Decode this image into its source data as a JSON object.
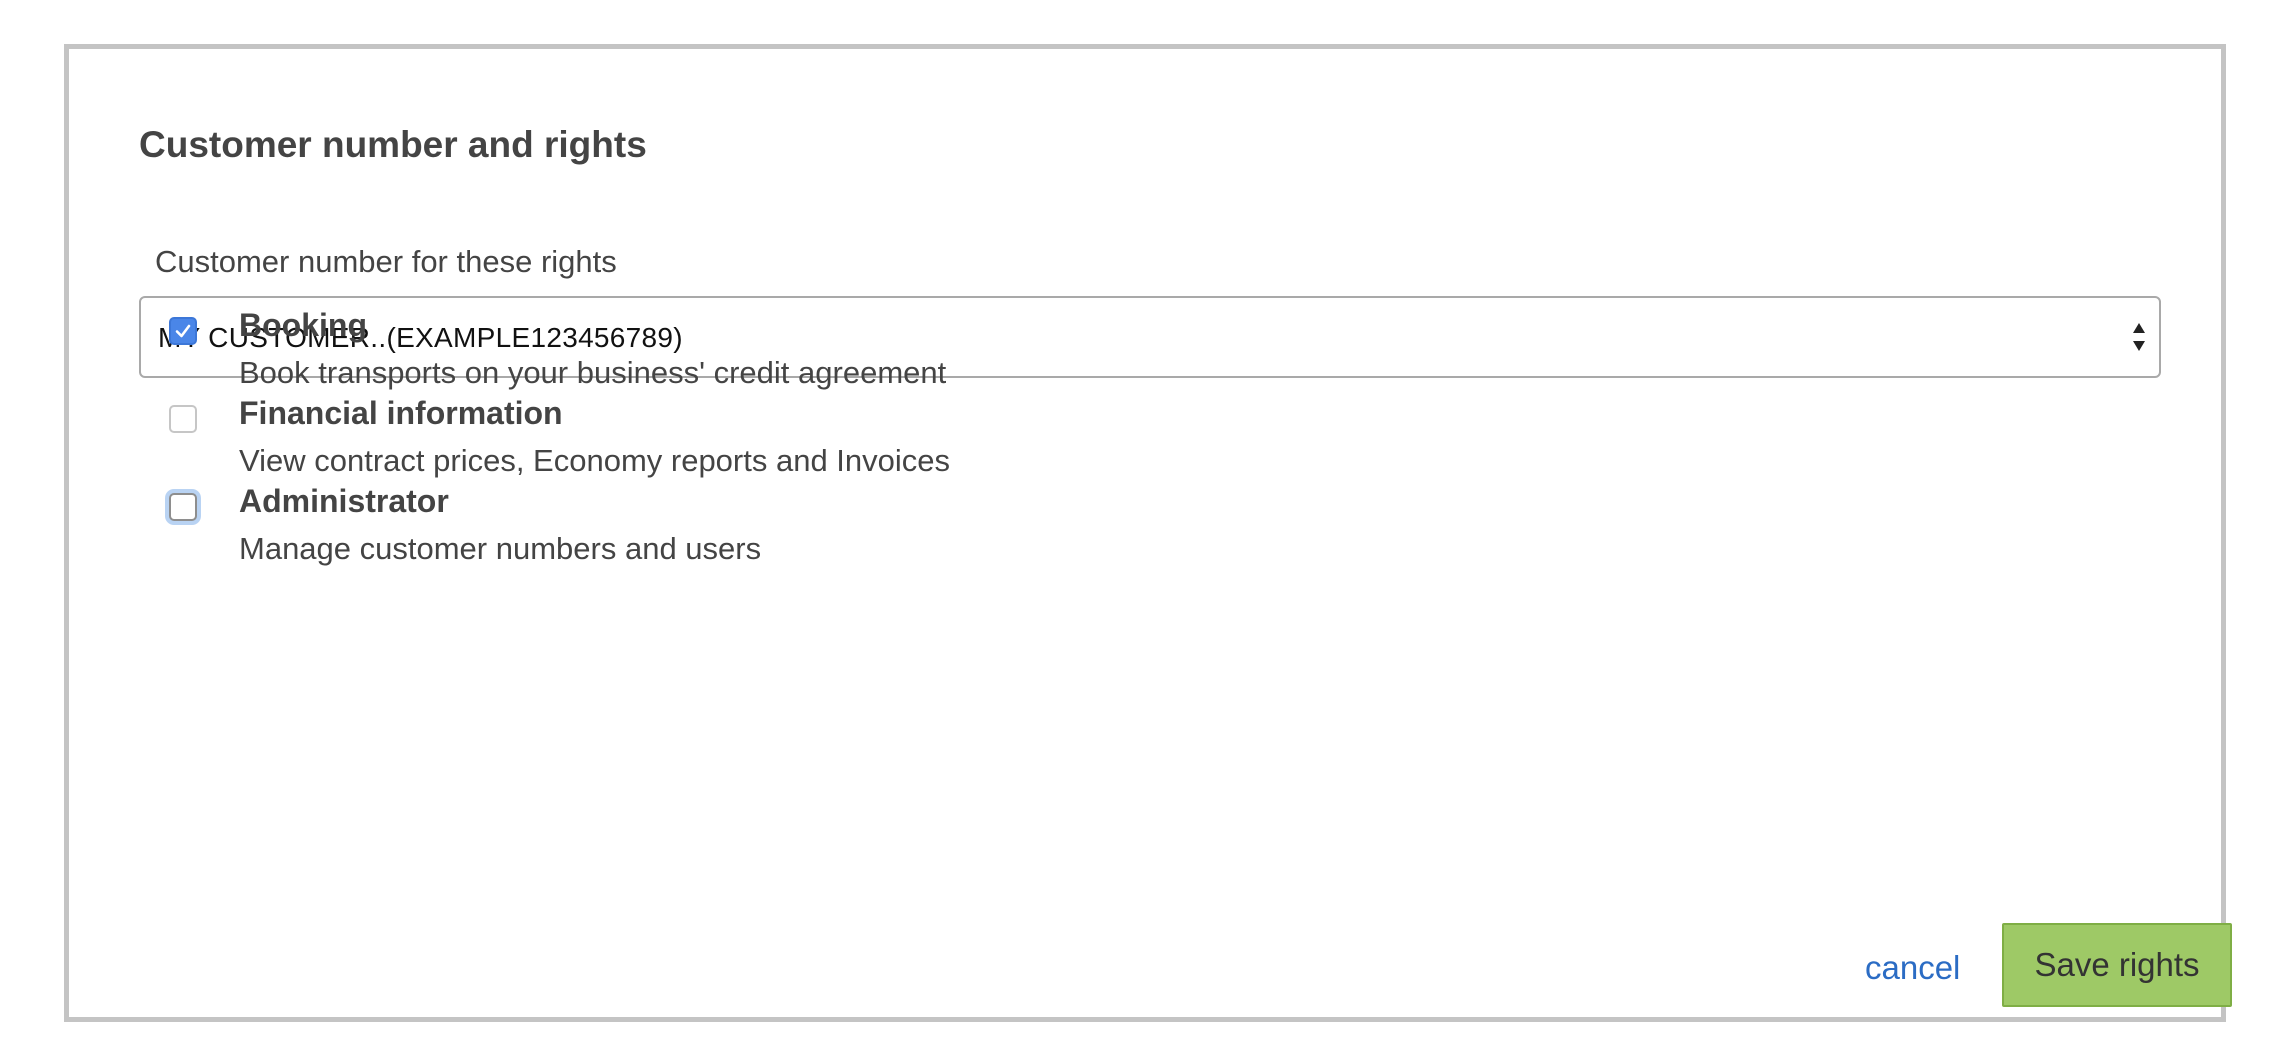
{
  "dialog": {
    "title": "Customer number and rights"
  },
  "customer_select": {
    "label": "Customer number for these rights",
    "selected_value": "MY CUSTOMER..(EXAMPLE123456789)"
  },
  "rights": [
    {
      "title": "Booking",
      "description": "Book transports on your business' credit agreement",
      "checked": true
    },
    {
      "title": "Financial information",
      "description": "View contract prices, Economy reports and Invoices",
      "checked": false
    },
    {
      "title": "Administrator",
      "description": "Manage customer numbers and users",
      "checked": false,
      "focused": true
    }
  ],
  "actions": {
    "cancel_label": "cancel",
    "save_label": "Save rights"
  },
  "colors": {
    "accent": "#4a86e8",
    "link": "#2b6cc4",
    "save_button": "#9ec966",
    "border": "#c4c4c4",
    "text": "#444444"
  },
  "icons": {
    "checkmark": "checkmark-icon",
    "select_arrows": "select-arrows-icon"
  }
}
